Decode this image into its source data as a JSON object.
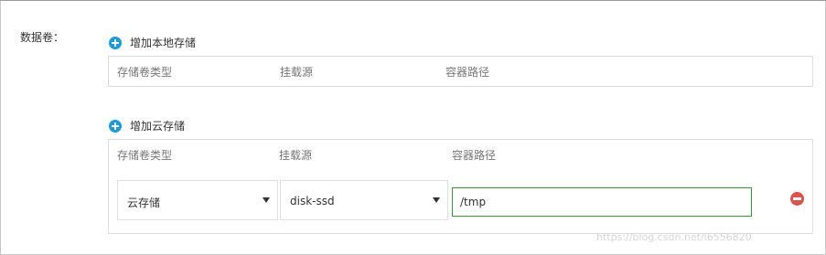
{
  "form": {
    "field_label": "数据卷："
  },
  "local_storage": {
    "add_label": "增加本地存储",
    "columns": [
      "存储卷类型",
      "挂载源",
      "容器路径"
    ]
  },
  "cloud_storage": {
    "add_label": "增加云存储",
    "columns": [
      "存储卷类型",
      "挂载源",
      "容器路径"
    ],
    "row": {
      "volume_type": "云存储",
      "mount_source": "disk-ssd",
      "container_path": "/tmp"
    }
  },
  "icons": {
    "add": "plus-circle-icon",
    "remove": "minus-circle-icon",
    "dropdown": "caret-down-icon"
  },
  "colors": {
    "add_icon": "#1f9ad6",
    "remove_icon": "#d9534f",
    "input_border_focus": "#3f8f3f"
  },
  "watermark": "https://blog.csdn.net/l6556820"
}
